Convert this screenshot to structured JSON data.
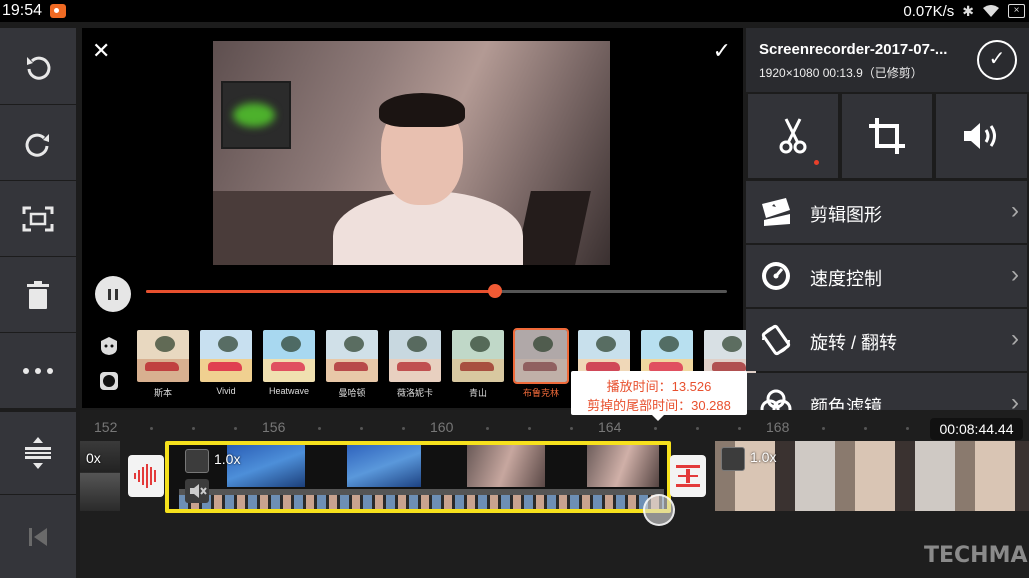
{
  "status_bar": {
    "time": "19:54",
    "net_speed": "0.07K/s"
  },
  "preview": {
    "progress": 0.6,
    "filters": [
      {
        "name": "斯本"
      },
      {
        "name": "Vivid"
      },
      {
        "name": "Heatwave"
      },
      {
        "name": "曼哈顿"
      },
      {
        "name": "薇洛妮卡"
      },
      {
        "name": "青山"
      },
      {
        "name": "布鲁克林",
        "selected": true
      },
      {
        "name": ""
      },
      {
        "name": ""
      },
      {
        "name": ""
      }
    ]
  },
  "right_panel": {
    "title": "Screenrecorder-2017-07-...",
    "info": "1920×1080  00:13.9（已修剪）",
    "menu": [
      {
        "label": "剪辑图形"
      },
      {
        "label": "速度控制"
      },
      {
        "label": "旋转 / 翻转"
      },
      {
        "label": "颜色滤镜"
      }
    ]
  },
  "timeline": {
    "ruler": [
      "152",
      "156",
      "160",
      "164",
      "168"
    ],
    "timecode": "00:08:44.44",
    "tooltip": {
      "line1": "播放时间：13.526",
      "line2": "剪掉的尾部时间：30.288"
    },
    "clips": [
      {
        "speed": "0x"
      },
      {
        "speed": "1.0x"
      },
      {
        "speed": "1.0x"
      }
    ]
  },
  "watermark": "TECHMAN"
}
